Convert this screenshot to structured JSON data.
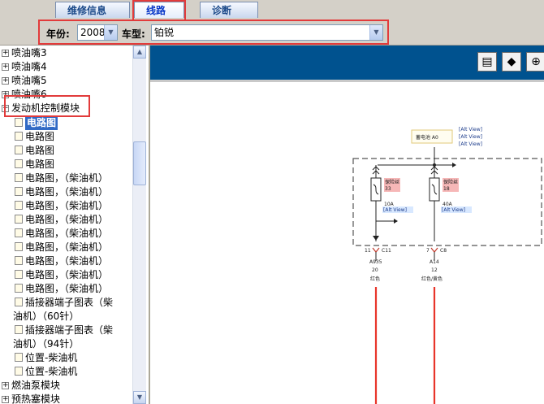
{
  "tabs": [
    {
      "label": "维修信息"
    },
    {
      "label": "线路"
    },
    {
      "label": "诊断"
    }
  ],
  "filter": {
    "year_label": "年份:",
    "year_value": "2008",
    "model_label": "车型:",
    "model_value": "铂锐"
  },
  "tree": {
    "nodes_top": [
      {
        "label": "喷油嘴3"
      },
      {
        "label": "喷油嘴4"
      },
      {
        "label": "喷油嘴5"
      },
      {
        "label": "喷油嘴6"
      },
      {
        "label": "发动机控制模块"
      }
    ],
    "leaves": [
      {
        "label": "电路图"
      },
      {
        "label": "电路图"
      },
      {
        "label": "电路图"
      },
      {
        "label": "电路图"
      },
      {
        "label": "电路图，（柴油机）"
      },
      {
        "label": "电路图，（柴油机）"
      },
      {
        "label": "电路图，（柴油机）"
      },
      {
        "label": "电路图，（柴油机）"
      },
      {
        "label": "电路图，（柴油机）"
      },
      {
        "label": "电路图，（柴油机）"
      },
      {
        "label": "电路图，（柴油机）"
      },
      {
        "label": "电路图，（柴油机）"
      },
      {
        "label": "电路图，（柴油机）"
      }
    ],
    "connector_60": {
      "line1": "插接器端子图表（柴",
      "line2": "油机）（60针）"
    },
    "connector_94": {
      "line1": "插接器端子图表（柴",
      "line2": "油机）（94针）"
    },
    "location_1": "位置-柴油机",
    "location_2": "位置-柴油机",
    "nodes_bottom": [
      {
        "label": "燃油泵模块"
      },
      {
        "label": "预热塞模块"
      }
    ],
    "expander_symbol": "+"
  },
  "toolbar": {
    "print_icon": "print-icon",
    "fit_icon": "fit-icon",
    "zoom_icon": "zoom-in-icon"
  },
  "schematic": {
    "battery_label": "蓄电池 A0",
    "alt_view": "[Alt View]",
    "fuse1": {
      "name": "保险丝",
      "num": "33",
      "rating": "10A"
    },
    "fuse2": {
      "name": "保险丝",
      "num": "18",
      "rating": "40A"
    },
    "conn1": {
      "pin": "11",
      "id": "C11",
      "wire": "A935",
      "gauge": "20",
      "color": "红色"
    },
    "conn2": {
      "pin": "7",
      "id": "C8",
      "wire": "A14",
      "gauge": "12",
      "color": "红色/黄色"
    },
    "wire_color": "#e8352a"
  }
}
